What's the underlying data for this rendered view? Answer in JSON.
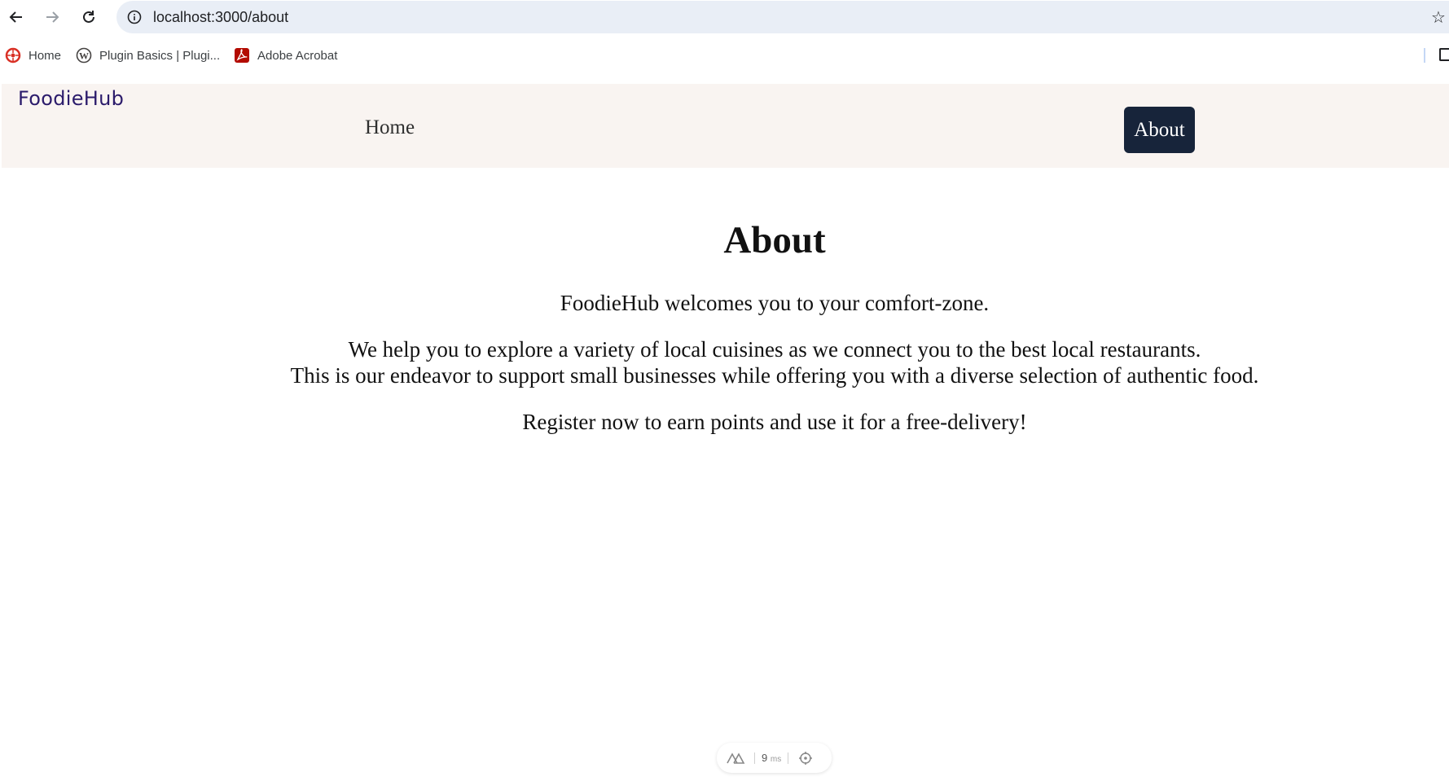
{
  "browser": {
    "url": "localhost:3000/about",
    "bookmarks": [
      {
        "label": "Home",
        "icon": "red-wheel-icon"
      },
      {
        "label": "Plugin Basics | Plugi...",
        "icon": "wordpress-icon"
      },
      {
        "label": "Adobe Acrobat",
        "icon": "acrobat-icon"
      }
    ]
  },
  "site": {
    "brand": "FoodieHub",
    "nav": {
      "home": "Home",
      "about": "About"
    },
    "colors": {
      "header_bg": "#f9f4f1",
      "active_nav_bg": "#17243a",
      "brand_color": "#2b1b6b"
    }
  },
  "content": {
    "title": "About",
    "paragraph1": "FoodieHub welcomes you to your comfort-zone.",
    "paragraph2_line1": "We help you to explore a variety of local cuisines as we connect you to the best local restaurants.",
    "paragraph2_line2": "This is our endeavor to support small businesses while offering you with a diverse selection of authentic food.",
    "paragraph3": "Register now to earn points and use it for a free-delivery!"
  },
  "dev_indicator": {
    "value": "9",
    "unit": "ms"
  }
}
